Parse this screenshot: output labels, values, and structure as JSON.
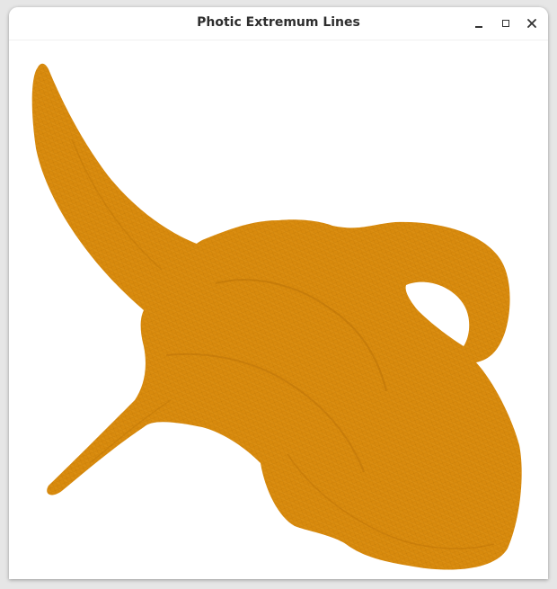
{
  "window": {
    "title": "Photic Extremum Lines"
  },
  "controls": {
    "minimize": "minimize-icon",
    "maximize": "maximize-icon",
    "close": "close-icon"
  },
  "render": {
    "subject": "horned head mesh",
    "mesh_color": "#D88A0D",
    "background_color": "#FFFFFF"
  }
}
